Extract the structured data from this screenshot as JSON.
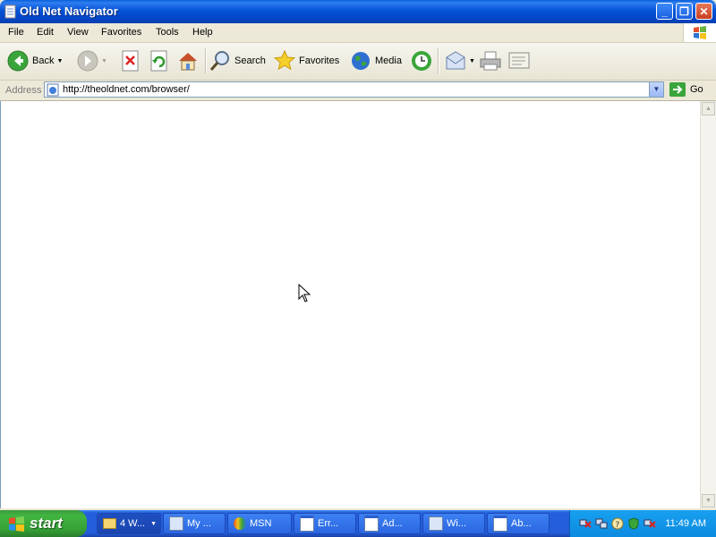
{
  "window": {
    "title": "Old Net Navigator"
  },
  "menu": [
    "File",
    "Edit",
    "View",
    "Favorites",
    "Tools",
    "Help"
  ],
  "toolbar": {
    "back": "Back",
    "search": "Search",
    "favorites": "Favorites",
    "media": "Media"
  },
  "address": {
    "label": "Address",
    "url": "http://theoldnet.com/browser/",
    "go": "Go"
  },
  "taskbar": {
    "start": "start",
    "tasks": [
      "4 W...",
      "My ...",
      "MSN",
      "Err...",
      "Ad...",
      "Wi...",
      "Ab..."
    ],
    "clock": "11:49 AM"
  },
  "colors": {
    "titlebar": "#0553d6",
    "taskbar": "#245edb",
    "start": "#3c9b3c",
    "tray": "#0c8ae0"
  }
}
